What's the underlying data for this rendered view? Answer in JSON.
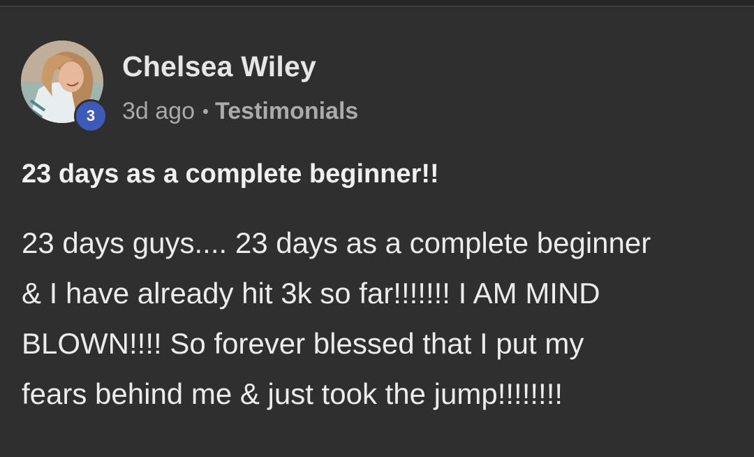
{
  "post": {
    "author": {
      "name": "Chelsea Wiley",
      "level": "3",
      "avatar": "user-avatar-photo"
    },
    "meta": {
      "time_ago": "3d ago",
      "category": "Testimonials"
    },
    "title": "23 days as a complete beginner!!",
    "body_lines": [
      "23 days guys.... 23 days as a complete beginner",
      "& I have already hit 3k so far!!!!!!! I AM MIND",
      "BLOWN!!!! So forever blessed that I put my",
      "fears behind me & just took the jump!!!!!!!!"
    ]
  },
  "colors": {
    "background": "#2f2f2f",
    "badge": "#3d5ab8",
    "name_text": "#e6e6e6",
    "meta_text": "#a9a9a9"
  }
}
